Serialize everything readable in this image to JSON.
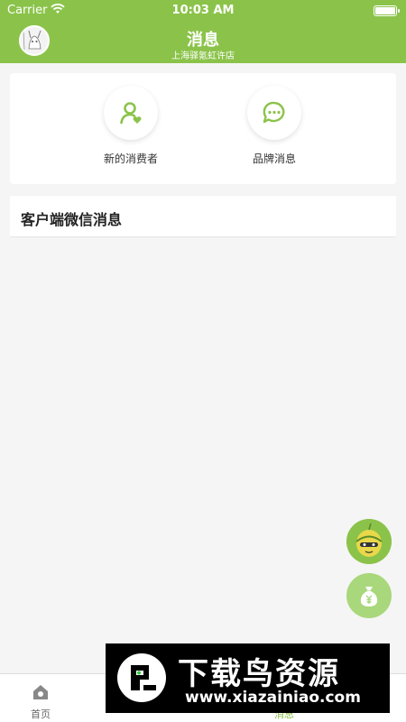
{
  "status_bar": {
    "carrier": "Carrier",
    "time": "10:03 AM"
  },
  "header": {
    "title": "消息",
    "subtitle": "上海驿氪虹许店",
    "accent_color": "#8bc34a"
  },
  "quick_actions": [
    {
      "label": "新的消费者",
      "icon": "user-heart-icon"
    },
    {
      "label": "品牌消息",
      "icon": "chat-bubble-icon"
    }
  ],
  "section": {
    "title": "客户端微信消息"
  },
  "floating_buttons": [
    {
      "icon": "mascot-icon"
    },
    {
      "icon": "money-bag-icon"
    }
  ],
  "tabbar": {
    "items": [
      {
        "label": "首页",
        "icon": "home-icon",
        "active": false
      },
      {
        "label": "",
        "icon": "tab-icon",
        "active": false
      },
      {
        "label": "",
        "icon": "tab-icon",
        "active": false
      },
      {
        "label": "消息",
        "icon": "message-icon",
        "active": true
      },
      {
        "label": "",
        "icon": "tab-icon",
        "active": false
      }
    ]
  },
  "watermark": {
    "title": "下载鸟资源",
    "url": "www.xiazainiao.com"
  }
}
